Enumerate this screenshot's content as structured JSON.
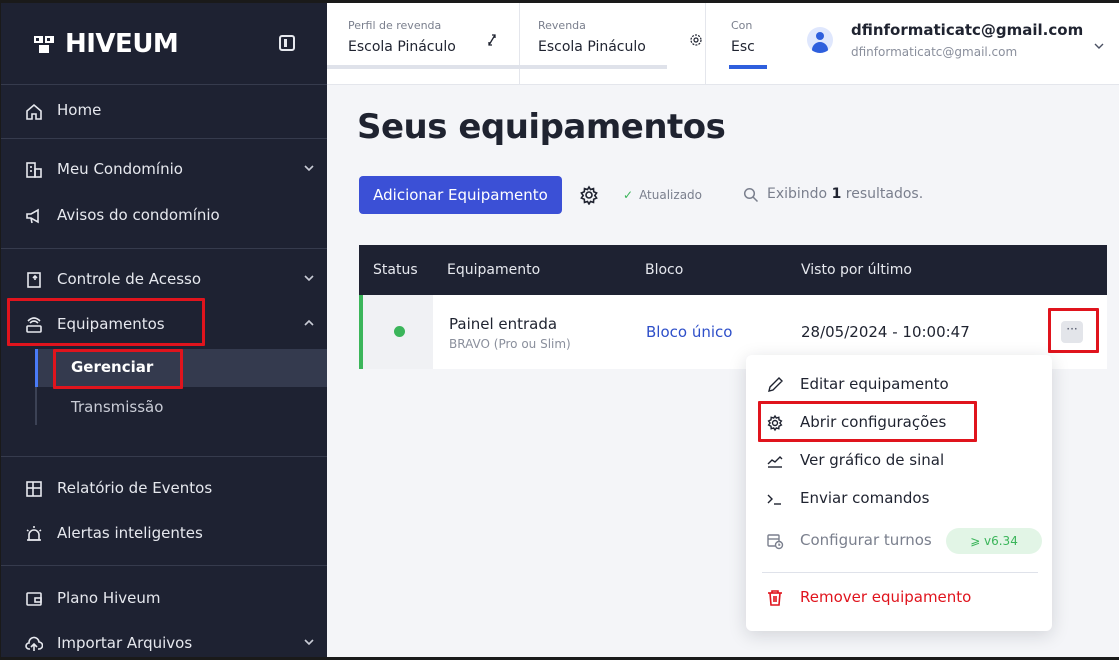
{
  "brand": {
    "name": "HIVEUM"
  },
  "sidebar": {
    "items": [
      {
        "label": "Home",
        "icon": "home-icon"
      },
      {
        "label": "Meu Condomínio",
        "icon": "building-icon"
      },
      {
        "label": "Avisos do condomínio",
        "icon": "megaphone-icon"
      },
      {
        "label": "Controle de Acesso",
        "icon": "door-icon"
      },
      {
        "label": "Equipamentos",
        "icon": "router-icon"
      },
      {
        "label": "Relatório de Eventos",
        "icon": "report-icon"
      },
      {
        "label": "Alertas inteligentes",
        "icon": "alarm-icon"
      },
      {
        "label": "Plano Hiveum",
        "icon": "wallet-icon"
      },
      {
        "label": "Importar Arquivos",
        "icon": "cloud-upload-icon"
      }
    ],
    "subitems": [
      {
        "label": "Gerenciar",
        "active": true
      },
      {
        "label": "Transmissão",
        "active": false
      }
    ]
  },
  "header": {
    "tabs": [
      {
        "caption": "Perfil de revenda",
        "value": "Escola Pináculo",
        "icon": "swap-icon"
      },
      {
        "caption": "Revenda",
        "value": "Escola Pináculo",
        "icon": "gear-icon"
      },
      {
        "caption": "Con",
        "value": "Esc",
        "active": true
      }
    ],
    "user": {
      "name": "dfinformaticatc@gmail.com",
      "email": "dfinformaticatc@gmail.com"
    }
  },
  "main": {
    "title": "Seus equipamentos",
    "add_button": "Adicionar Equipamento",
    "updated_label": "Atualizado",
    "results_prefix": "Exibindo",
    "results_count": "1",
    "results_suffix": "resultados.",
    "table": {
      "columns": [
        "Status",
        "Equipamento",
        "Bloco",
        "Visto por último"
      ],
      "rows": [
        {
          "status": "online",
          "name": "Painel entrada",
          "model": "BRAVO (Pro ou Slim)",
          "bloco": "Bloco único",
          "last_seen": "28/05/2024 - 10:00:47",
          "more": "···"
        }
      ]
    }
  },
  "menu": {
    "items": [
      {
        "label": "Editar equipamento",
        "icon": "pencil-icon"
      },
      {
        "label": "Abrir configurações",
        "icon": "gear-icon"
      },
      {
        "label": "Ver gráfico de sinal",
        "icon": "signal-chart-icon"
      },
      {
        "label": "Enviar comandos",
        "icon": "terminal-icon"
      },
      {
        "label": "Configurar turnos",
        "icon": "calendar-clock-icon",
        "badge": "⩾ v6.34"
      },
      {
        "label": "Remover equipamento",
        "icon": "trash-icon"
      }
    ]
  },
  "colors": {
    "sidebar_bg": "#1e2232",
    "primary": "#3b50d6",
    "online": "#3bb55a",
    "danger": "#e0141d",
    "highlight_box": "#e0141d"
  }
}
